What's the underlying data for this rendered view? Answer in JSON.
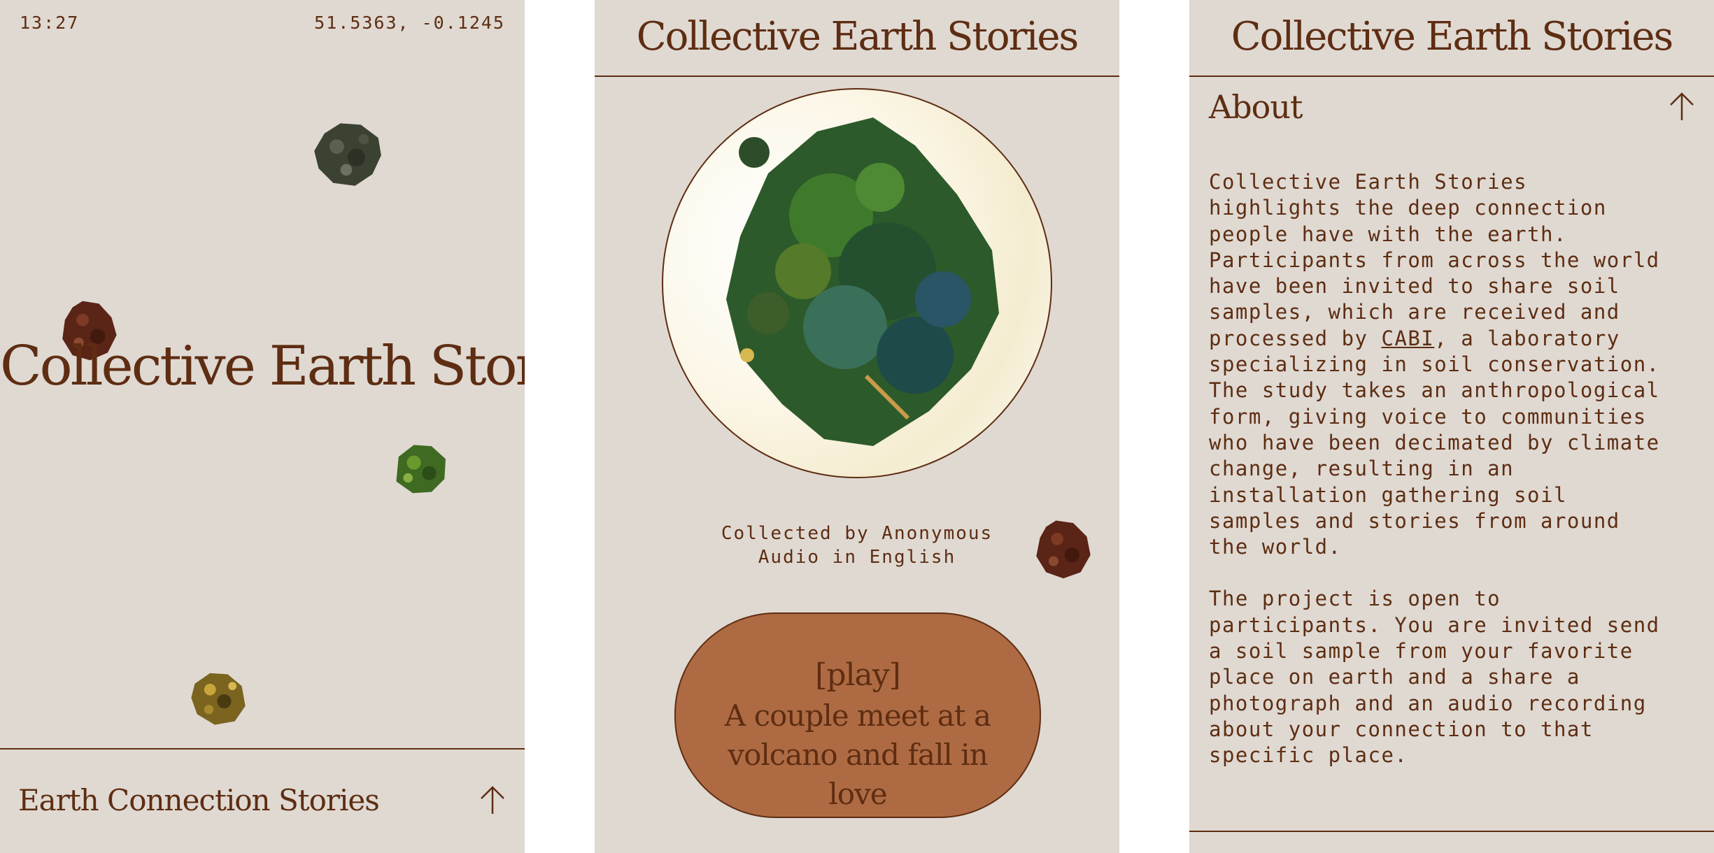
{
  "screen1": {
    "status": {
      "time": "13:27",
      "coords": "51.5363, -0.1245"
    },
    "hero_title": "Collective Earth Stories",
    "bottom_label": "Earth Connection Stories",
    "bottom_icon": "arrow-up-icon"
  },
  "screen2": {
    "title": "Collective Earth Stories",
    "caption": {
      "collected_by": "Collected by Anonymous",
      "audio": "Audio in English"
    },
    "play_button": {
      "play": "[play]",
      "story": "A couple meet at a volcano and fall in love"
    }
  },
  "screen3": {
    "title": "Collective Earth Stories",
    "about_label": "About",
    "about_icon": "arrow-up-icon",
    "para1_before": "Collective Earth Stories highlights the deep connection people have with the earth. Participants from across the world have been invited to share soil samples, which are received and processed by ",
    "para1_link": "CABI",
    "para1_after": ", a laboratory specializing in soil conservation. The study takes an anthropological form, giving voice to communities who have been decimated by climate change, resulting in an installation gathering soil samples and stories from around the world.",
    "para2": "The project is open to participants. You are invited send a soil sample from your favorite place on earth and a share a photograph and an audio recording about your connection to that specific place."
  },
  "colors": {
    "background": "#dfd9d2",
    "text": "#5e2d12",
    "play_button": "#ae6b43"
  }
}
